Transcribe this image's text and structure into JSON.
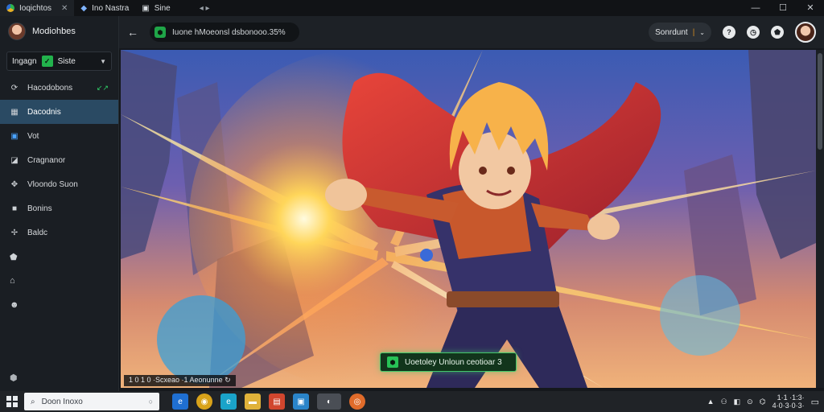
{
  "titlebar": {
    "tabs": [
      {
        "label": "Ioqichtos",
        "active": true
      },
      {
        "label": "Ino Nastra",
        "active": false
      },
      {
        "label": "Sine",
        "active": false
      }
    ],
    "controls": [
      "—",
      "☐",
      "✕"
    ]
  },
  "sidebar": {
    "profile_name": "Modiohbes",
    "selector": {
      "left_label": "Ingagn",
      "right_label": "Siste"
    },
    "items": [
      {
        "label": "Hacodobons",
        "icon": "refresh-icon",
        "badge": "↙↗",
        "active": false
      },
      {
        "label": "Dacodnis",
        "icon": "calendar-icon",
        "active": true
      },
      {
        "label": "Vot",
        "icon": "square-icon",
        "active": false
      },
      {
        "label": "Cragnanor",
        "icon": "tag-icon",
        "active": false
      },
      {
        "label": "Vloondo Suon",
        "icon": "gamepad-icon",
        "active": false
      },
      {
        "label": "Bonins",
        "icon": "box-icon",
        "active": false
      },
      {
        "label": "Baldc",
        "icon": "puzzle-icon",
        "active": false
      }
    ],
    "extra_icons": [
      "shield-icon",
      "home-icon",
      "people-icon"
    ],
    "bottom_icon": "settings-icon"
  },
  "topbar": {
    "url_text": "Iuone hMoeonsl dsbonooo.35%",
    "dropdown_label": "Sonrdunt",
    "icons": [
      "help-icon",
      "clock-icon",
      "shield-icon",
      "user-avatar"
    ]
  },
  "content": {
    "status_text": "1 0 1 0 ·Scxeao ·1 Aeonunne ↻",
    "unlock_button_label": "Uoetoley Unloun ceotioar 3"
  },
  "taskbar": {
    "search_placeholder": "Doon Inoxo",
    "apps": [
      {
        "name": "browser-icon",
        "color": "#1f6fd1"
      },
      {
        "name": "chrome-icon",
        "color": "#d9a31a"
      },
      {
        "name": "edge-icon",
        "color": "#1aa3c9"
      },
      {
        "name": "folder-icon",
        "color": "#e0b23a"
      },
      {
        "name": "store-icon",
        "color": "#d1462e"
      },
      {
        "name": "window-icon",
        "color": "#2a84c9"
      },
      {
        "name": "game-app-icon",
        "color": "#6b6f75"
      },
      {
        "name": "media-icon",
        "color": "#e06b2a"
      }
    ],
    "tray_icons": [
      "up-arrow-icon",
      "network-icon",
      "speaker-icon",
      "battery-icon",
      "wifi-icon"
    ],
    "clock_time": "1·1 ·1:3·",
    "clock_date": "4·0·3·0·3·"
  }
}
